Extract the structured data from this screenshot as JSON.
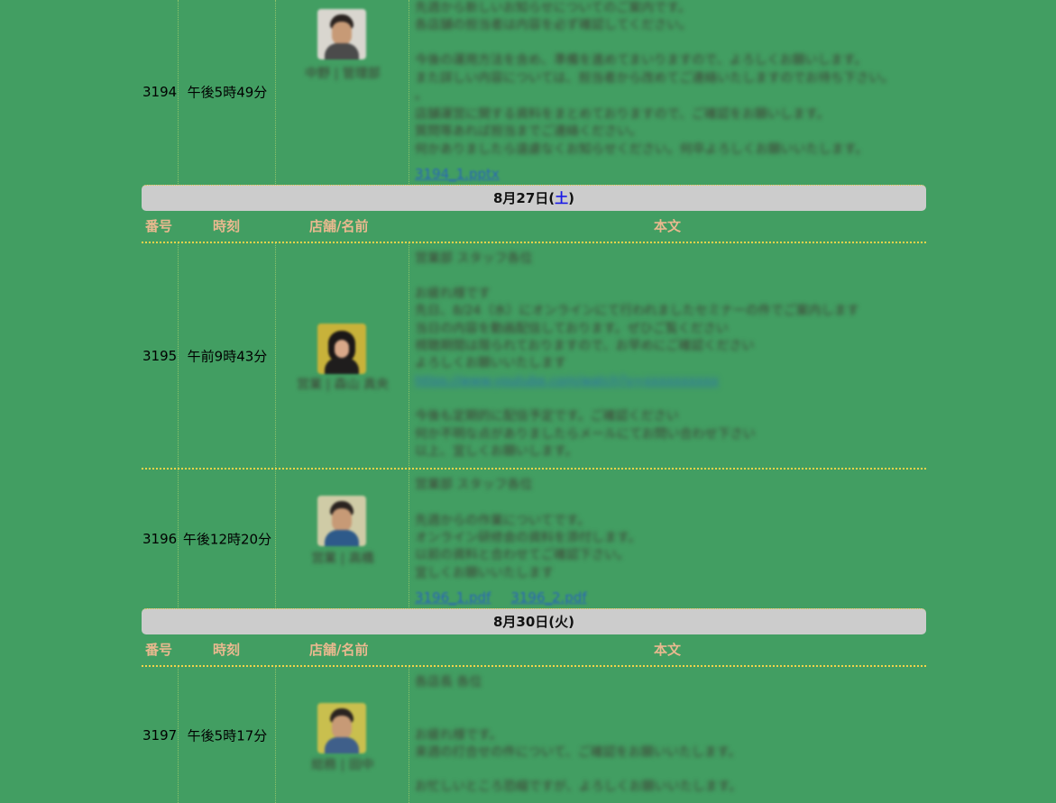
{
  "posts": [
    {
      "number": "3194",
      "time": "午後5時49分",
      "name": "中野 | 管理部",
      "body_lines": [
        "先週から新しいお知らせについてのご案内です。",
        "各店舗の担当者は内容を必ず確認してください。",
        "",
        "今後の運用方法を含め、準備を進めてまいりますので、よろしくお願いします。",
        "また詳しい内容については、担当者から改めてご連絡いたしますのでお待ち下さい。",
        "。",
        "店舗運営に関する資料をまとめておりますので、ご確認をお願いします。",
        "質問等あれば担当までご連絡ください。",
        "何かありましたら遠慮なくお知らせください。何卒よろしくお願いいたします。"
      ],
      "attachments": [
        "3194_1.pptx"
      ]
    },
    {
      "number": "3195",
      "time": "午前9時43分",
      "name": "営業 | 森山 真央",
      "body_lines": [
        "営業部 スタッフ各位",
        "",
        "お疲れ様です",
        "先日、8/24（水）にオンラインにて行われましたセミナーの件でご案内します",
        "当日の内容を動画配信しております。ぜひご覧ください",
        "視聴期間は限られておりますので、お早めにご確認ください",
        "よろしくお願いいたします",
        "https://www.youtube.com/watch?v=xxxxxxxxxx",
        "",
        "今後も定期的に配信予定です。ご確認ください",
        "何か不明な点がありましたらメールにてお問い合わせ下さい",
        "以上、宜しくお願いします。"
      ],
      "attachments": []
    },
    {
      "number": "3196",
      "time": "午後12時20分",
      "name": "営業 | 高橋",
      "body_lines": [
        "営業部 スタッフ各位",
        "",
        "先週からの作業についてです。",
        "オンライン研修会の資料を添付します。",
        "以前の資料と合わせてご確認下さい。",
        "宜しくお願いいたします"
      ],
      "attachments": [
        "3196_1.pdf",
        "3196_2.pdf"
      ]
    },
    {
      "number": "3197",
      "time": "午後5時17分",
      "name": "総務 | 田中",
      "body_lines": [
        "各店長 各位",
        "",
        "",
        "お疲れ様です。",
        "来週の打合せの件について、ご確認をお願いいたします。",
        "",
        "お忙しいところ恐縮ですが、よろしくお願いいたします。"
      ],
      "attachments": []
    }
  ],
  "dates": [
    {
      "main": "8月27日(",
      "weekday": "土",
      "close": ")",
      "weekday_color": "#1a1ae6"
    },
    {
      "main": "8月30日(",
      "weekday": "火",
      "close": ")",
      "weekday_color": "#111111"
    }
  ],
  "headers": {
    "number": "番号",
    "time": "時刻",
    "name": "店舗/名前",
    "body": "本文"
  },
  "colors": {
    "background": "#429e62",
    "date_bar": "#cccccc",
    "header_text": "#e9b98f",
    "separator": "#f1d34a",
    "link": "#2a66b8"
  }
}
